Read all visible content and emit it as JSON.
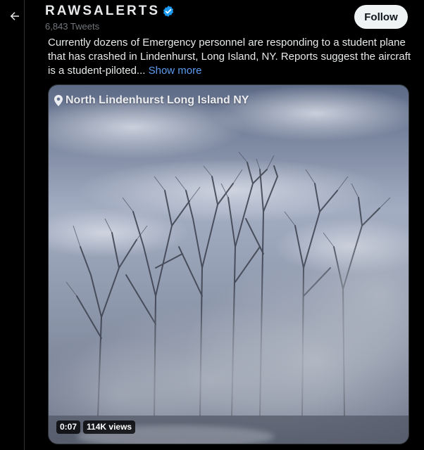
{
  "header": {
    "handle": "RAWSALERTS",
    "tweet_count": "6,843 Tweets",
    "follow_label": "Follow"
  },
  "tweet": {
    "text": "Currently dozens of Emergency personnel are responding to a student plane that has crashed in Lindenhurst, Long Island, NY.  Reports suggest the aircraft is a student-piloted...",
    "show_more": "Show more"
  },
  "media": {
    "location": "North Lindenhurst Long Island NY",
    "duration": "0:07",
    "views": "114K views"
  },
  "colors": {
    "background": "#000000",
    "text": "#e7e9ea",
    "muted": "#71767b",
    "link": "#5b9cf0",
    "verified": "#1d9bf0",
    "follow_bg": "#eff3f4"
  },
  "icons": {
    "back": "arrow-left-icon",
    "verified": "verified-badge-icon",
    "location": "location-pin-icon"
  }
}
